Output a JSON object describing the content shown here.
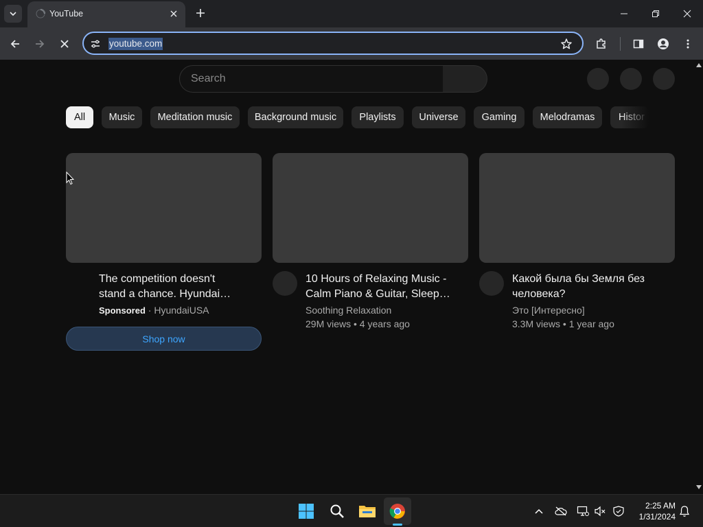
{
  "browser": {
    "tab_title": "YouTube",
    "url": "youtube.com"
  },
  "youtube": {
    "search_placeholder": "Search",
    "chips": [
      "All",
      "Music",
      "Meditation music",
      "Background music",
      "Playlists",
      "Universe",
      "Gaming",
      "Melodramas",
      "Histor"
    ],
    "videos": [
      {
        "title_line1": "The competition doesn't",
        "title_line2": "stand a chance. Hyundai…",
        "sponsored_label": "Sponsored",
        "advertiser": "· HyundaiUSA",
        "cta": "Shop now"
      },
      {
        "title_line1": "10 Hours of Relaxing Music -",
        "title_line2": "Calm Piano & Guitar, Sleep…",
        "channel": "Soothing Relaxation",
        "stats": "29M views • 4 years ago"
      },
      {
        "title_line1": "Какой была бы Земля без",
        "title_line2": "человека?",
        "channel": "Это [Интересно]",
        "stats": "3.3M views • 1 year ago"
      }
    ]
  },
  "taskbar": {
    "time": "2:25 AM",
    "date": "1/31/2024"
  },
  "colors": {
    "accent": "#8ab4f8",
    "youtube_bg": "#0f0f0f",
    "link_blue": "#3ea6ff",
    "windows_blue": "#4cc2ff"
  }
}
